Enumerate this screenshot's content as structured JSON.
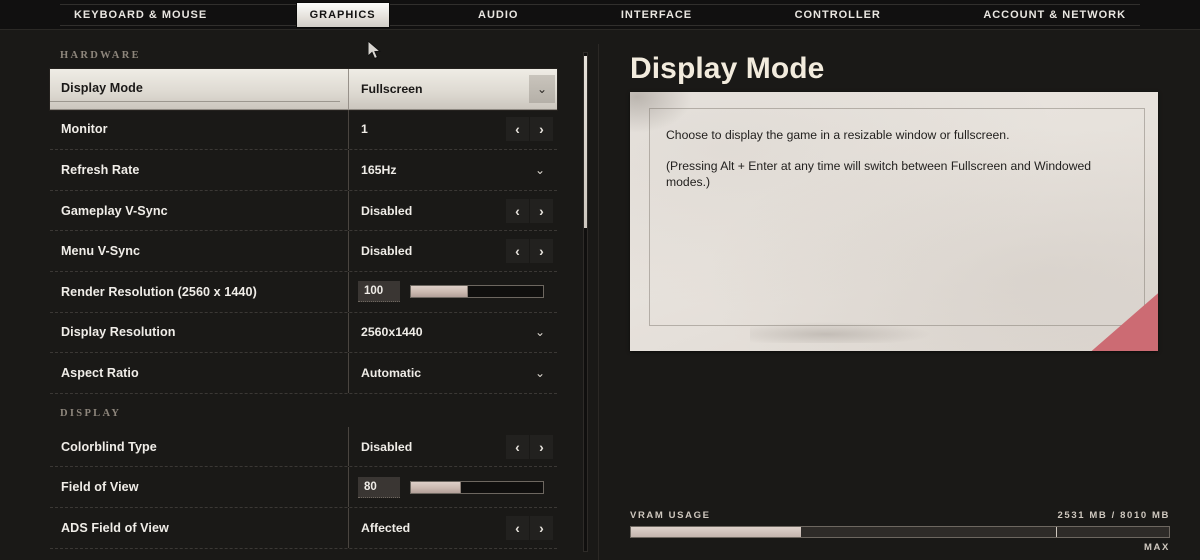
{
  "tabs": [
    {
      "label": "KEYBOARD & MOUSE",
      "active": false
    },
    {
      "label": "GRAPHICS",
      "active": true
    },
    {
      "label": "AUDIO",
      "active": false
    },
    {
      "label": "INTERFACE",
      "active": false
    },
    {
      "label": "CONTROLLER",
      "active": false
    },
    {
      "label": "ACCOUNT & NETWORK",
      "active": false
    }
  ],
  "sections": [
    {
      "title": "HARDWARE",
      "rows": [
        {
          "label": "Display Mode",
          "value": "Fullscreen",
          "control": "dropdown",
          "selected": true
        },
        {
          "label": "Monitor",
          "value": "1",
          "control": "stepper",
          "selected": false
        },
        {
          "label": "Refresh Rate",
          "value": "165Hz",
          "control": "dropdown",
          "selected": false
        },
        {
          "label": "Gameplay V-Sync",
          "value": "Disabled",
          "control": "stepper",
          "selected": false
        },
        {
          "label": "Menu V-Sync",
          "value": "Disabled",
          "control": "stepper",
          "selected": false
        },
        {
          "label": "Render Resolution (2560 x 1440)",
          "value": "100",
          "control": "slider",
          "fill_pct": 43,
          "selected": false
        },
        {
          "label": "Display Resolution",
          "value": "2560x1440",
          "control": "dropdown",
          "selected": false
        },
        {
          "label": "Aspect Ratio",
          "value": "Automatic",
          "control": "dropdown",
          "selected": false
        }
      ]
    },
    {
      "title": "DISPLAY",
      "rows": [
        {
          "label": "Colorblind Type",
          "value": "Disabled",
          "control": "stepper",
          "selected": false
        },
        {
          "label": "Field of View",
          "value": "80",
          "control": "slider",
          "fill_pct": 38,
          "selected": false
        },
        {
          "label": "ADS Field of View",
          "value": "Affected",
          "control": "stepper",
          "selected": false
        }
      ]
    }
  ],
  "icons": {
    "chevron_down": "⌄",
    "arrow_left": "‹",
    "arrow_right": "›"
  },
  "preview": {
    "title": "Display Mode",
    "description_line_1": "Choose to display the game in a resizable window or fullscreen.",
    "description_line_2": "(Pressing Alt + Enter at any time will switch between Fullscreen and Windowed modes.)"
  },
  "vram": {
    "label": "VRAM USAGE",
    "readout": "2531 MB / 8010 MB",
    "max_label": "MAX",
    "used_mb": 2531,
    "total_mb": 8010,
    "fill_pct": 31.6,
    "max_tick_pct": 79
  },
  "colors": {
    "background": "#1a1917",
    "accent_light": "#e9e6e1",
    "slider_fill": "#cbb9b0",
    "stripe_red": "#cc6b73",
    "section_head": "#8e867c"
  }
}
